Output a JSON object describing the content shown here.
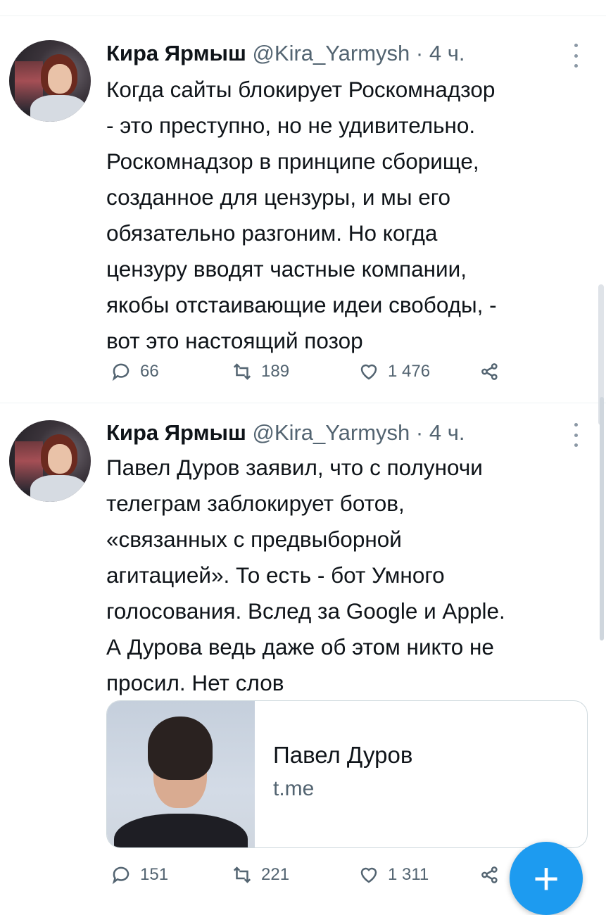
{
  "tweets": [
    {
      "author_name": "Кира Ярмыш",
      "handle": "@Kira_Yarmysh",
      "separator": "·",
      "time": "4 ч.",
      "text_lines": [
        "Когда сайты блокирует Роскомнадзор",
        "- это преступно, но не удивительно.",
        "Роскомнадзор в принципе сборище,",
        "созданное для цензуры, и мы его",
        "обязательно разгоним. Но когда",
        "цензуру вводят частные компании,",
        "якобы отстаивающие идеи свободы, -",
        "вот это настоящий позор"
      ],
      "replies": "66",
      "retweets": "189",
      "likes": "1 476"
    },
    {
      "author_name": "Кира Ярмыш",
      "handle": "@Kira_Yarmysh",
      "separator": "·",
      "time": "4 ч.",
      "text_lines": [
        "Павел Дуров заявил, что с полуночи",
        "телеграм заблокирует ботов,",
        "«связанных с предвыборной",
        "агитацией». То есть - бот Умного",
        "голосования. Вслед за Google и Apple.",
        "А Дурова ведь даже об этом никто не",
        "просил. Нет слов"
      ],
      "card": {
        "title": "Павел Дуров",
        "domain": "t.me"
      },
      "replies": "151",
      "retweets": "221",
      "likes": "1 311"
    }
  ],
  "fab_label": "+",
  "icons": {
    "reply": "reply-icon",
    "retweet": "retweet-icon",
    "like": "heart-icon",
    "share": "share-icon",
    "more": "more-icon",
    "compose": "plus-icon"
  },
  "colors": {
    "accent": "#1d9bf0",
    "secondary_text": "#536471",
    "primary_text": "#0f1419"
  }
}
